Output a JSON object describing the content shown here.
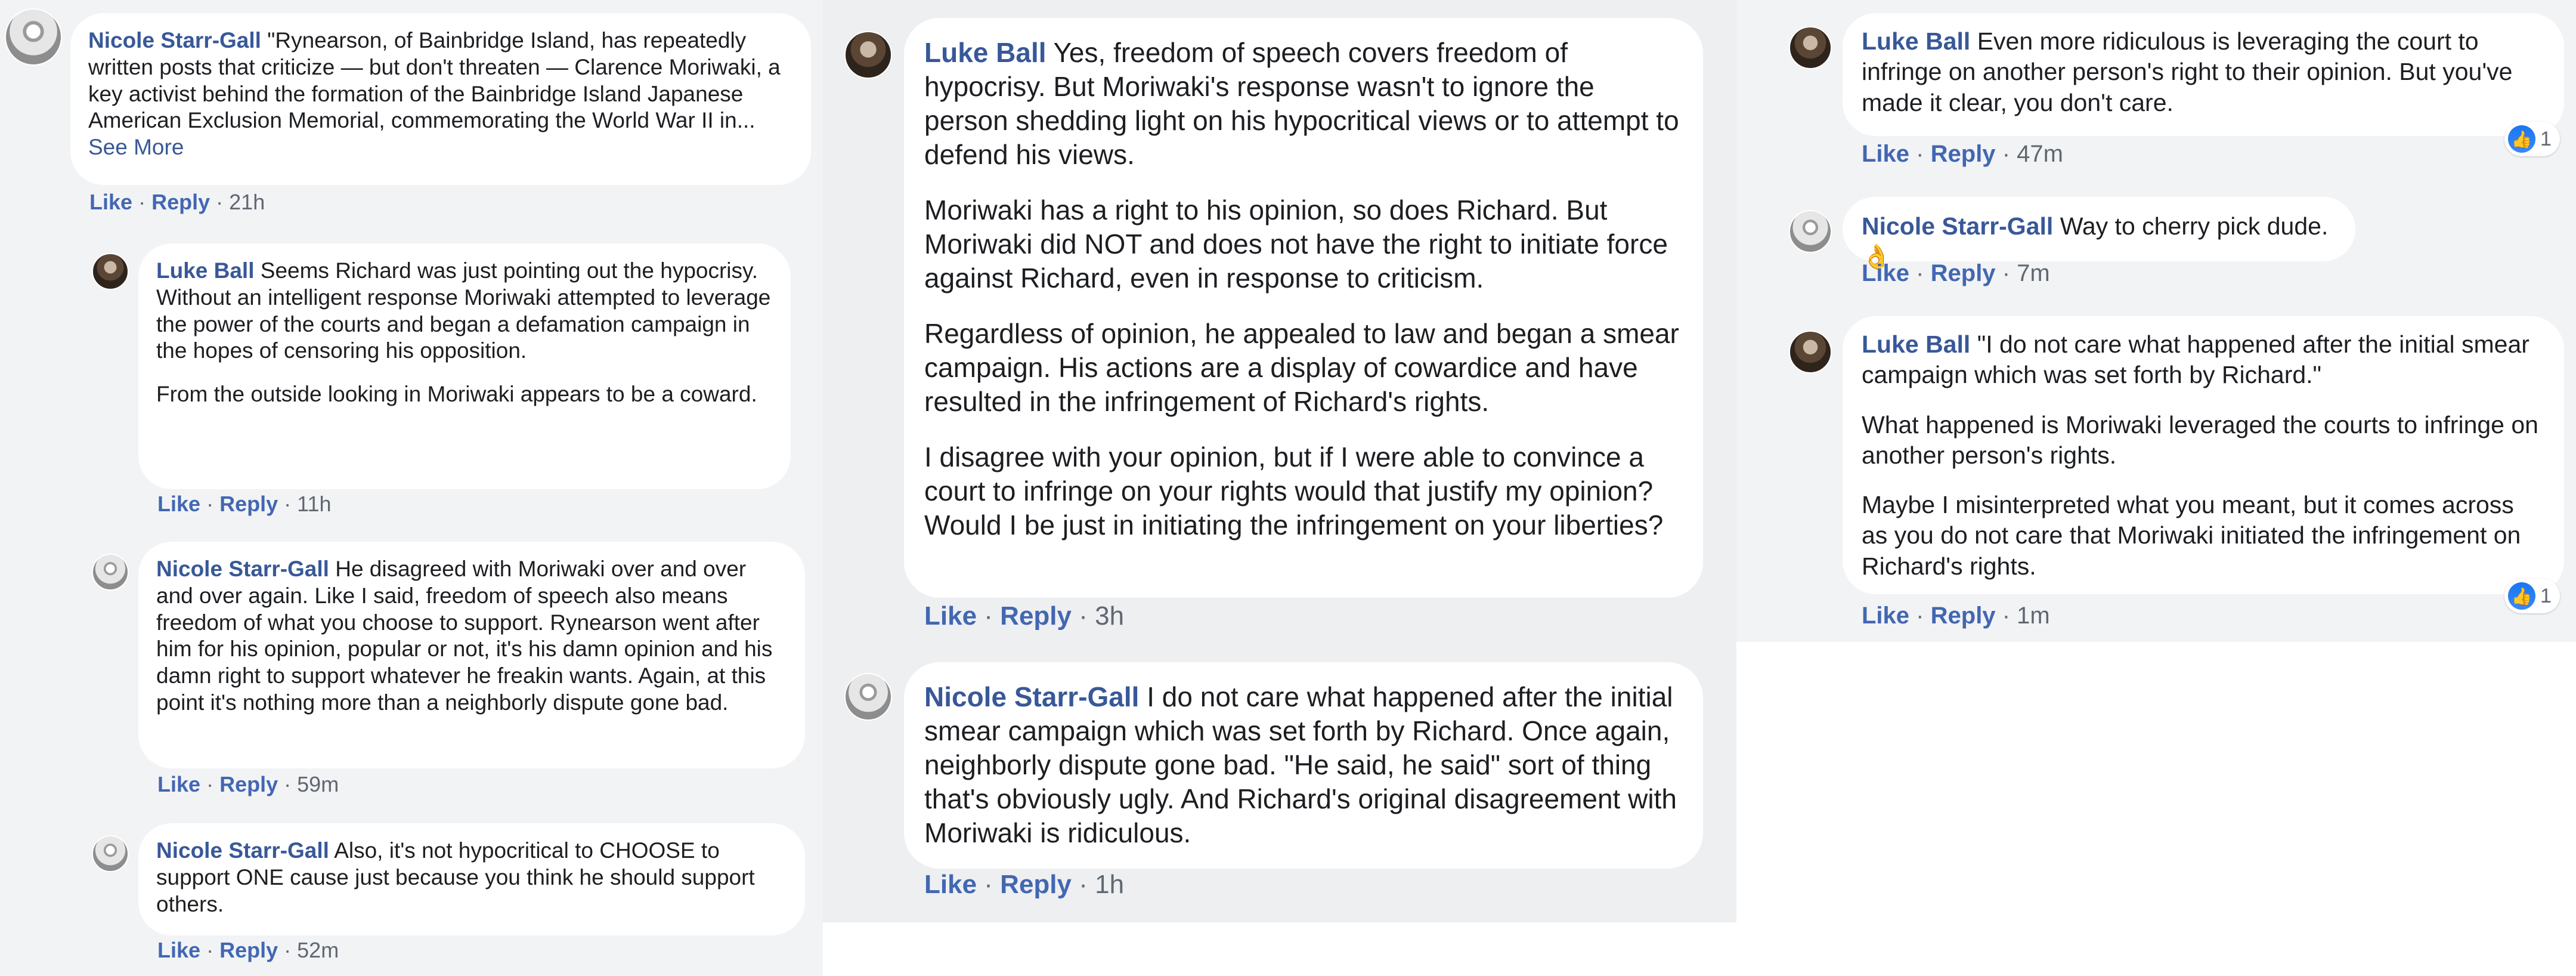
{
  "colors": {
    "author": "#385898",
    "action_link": "#4267b2",
    "meta": "#606770",
    "bubble": "#ffffff",
    "background": "#f2f3f5",
    "like_blue": "#1877f2"
  },
  "actions": {
    "like": "Like",
    "reply": "Reply",
    "separator": "·"
  },
  "panel1": {
    "c1": {
      "author": "Nicole Starr-Gall",
      "text": "\"Rynearson, of Bainbridge Island, has repeatedly written posts that criticize — but don't threaten — Clarence Moriwaki, a key activist behind the formation of the Bainbridge Island Japanese American Exclusion Memorial, commemorating the World War II in...",
      "see_more": "See More",
      "time": "21h"
    },
    "c2": {
      "author": "Luke Ball",
      "p1": "Seems Richard was just pointing out the hypocrisy. Without an intelligent response Moriwaki attempted to leverage the power of the courts and began a defamation campaign in the hopes of censoring his opposition.",
      "p2": "From the outside looking in Moriwaki appears to be a coward.",
      "time": "11h"
    },
    "c3": {
      "author": "Nicole Starr-Gall",
      "text": "He disagreed with Moriwaki over and over and over again. Like I said, freedom of speech also means freedom of what you choose to support. Rynearson went after him for his opinion, popular or not, it's his damn opinion and his damn right to support whatever he freakin wants. Again, at this point it's nothing more than a neighborly dispute gone bad.",
      "time": "59m"
    },
    "c4": {
      "author": "Nicole Starr-Gall",
      "text": "Also, it's not hypocritical to CHOOSE to support ONE cause just because you think he should support others.",
      "time": "52m"
    }
  },
  "panel2": {
    "c1": {
      "author": "Luke Ball",
      "p1": "Yes, freedom of speech covers freedom of hypocrisy. But Moriwaki's response wasn't to ignore the person shedding light on his hypocritical views or to attempt to defend his views.",
      "p2": "Moriwaki has a right to his opinion, so does Richard. But Moriwaki did NOT and does not have the right to initiate force against Richard, even in response to criticism.",
      "p3": "Regardless of opinion, he appealed to law and began a smear campaign. His actions are a display of cowardice and have resulted in the infringement of Richard's rights.",
      "p4": "I disagree with your opinion, but if I were able to convince a court to infringe on your rights would that justify my opinion? Would I be just in initiating the infringement on your liberties?",
      "time": "3h"
    },
    "c2": {
      "author": "Nicole Starr-Gall",
      "text": "I do not care what happened after the initial smear campaign which was set forth by Richard. Once again, neighborly dispute gone bad. \"He said, he said\" sort of thing that's obviously ugly. And Richard's original disagreement with Moriwaki is ridiculous.",
      "time": "1h"
    }
  },
  "panel3": {
    "c1": {
      "author": "Luke Ball",
      "text": "Even more ridiculous is leveraging the court to infringe on another person's right to their opinion. But you've made it clear, you don't care.",
      "time": "47m",
      "reaction_count": "1"
    },
    "c2": {
      "author": "Nicole Starr-Gall",
      "text": "Way to cherry pick dude.",
      "emoji": "👌",
      "time": "7m"
    },
    "c3": {
      "author": "Luke Ball",
      "p1": "\"I do not care what happened after the initial smear campaign which was set forth by Richard.\"",
      "p2": "What happened is Moriwaki leveraged the courts to infringe on another person's rights.",
      "p3": "Maybe I misinterpreted what you meant, but it comes across as you do not care that Moriwaki initiated the infringement on Richard's rights.",
      "time": "1m",
      "reaction_count": "1"
    }
  }
}
